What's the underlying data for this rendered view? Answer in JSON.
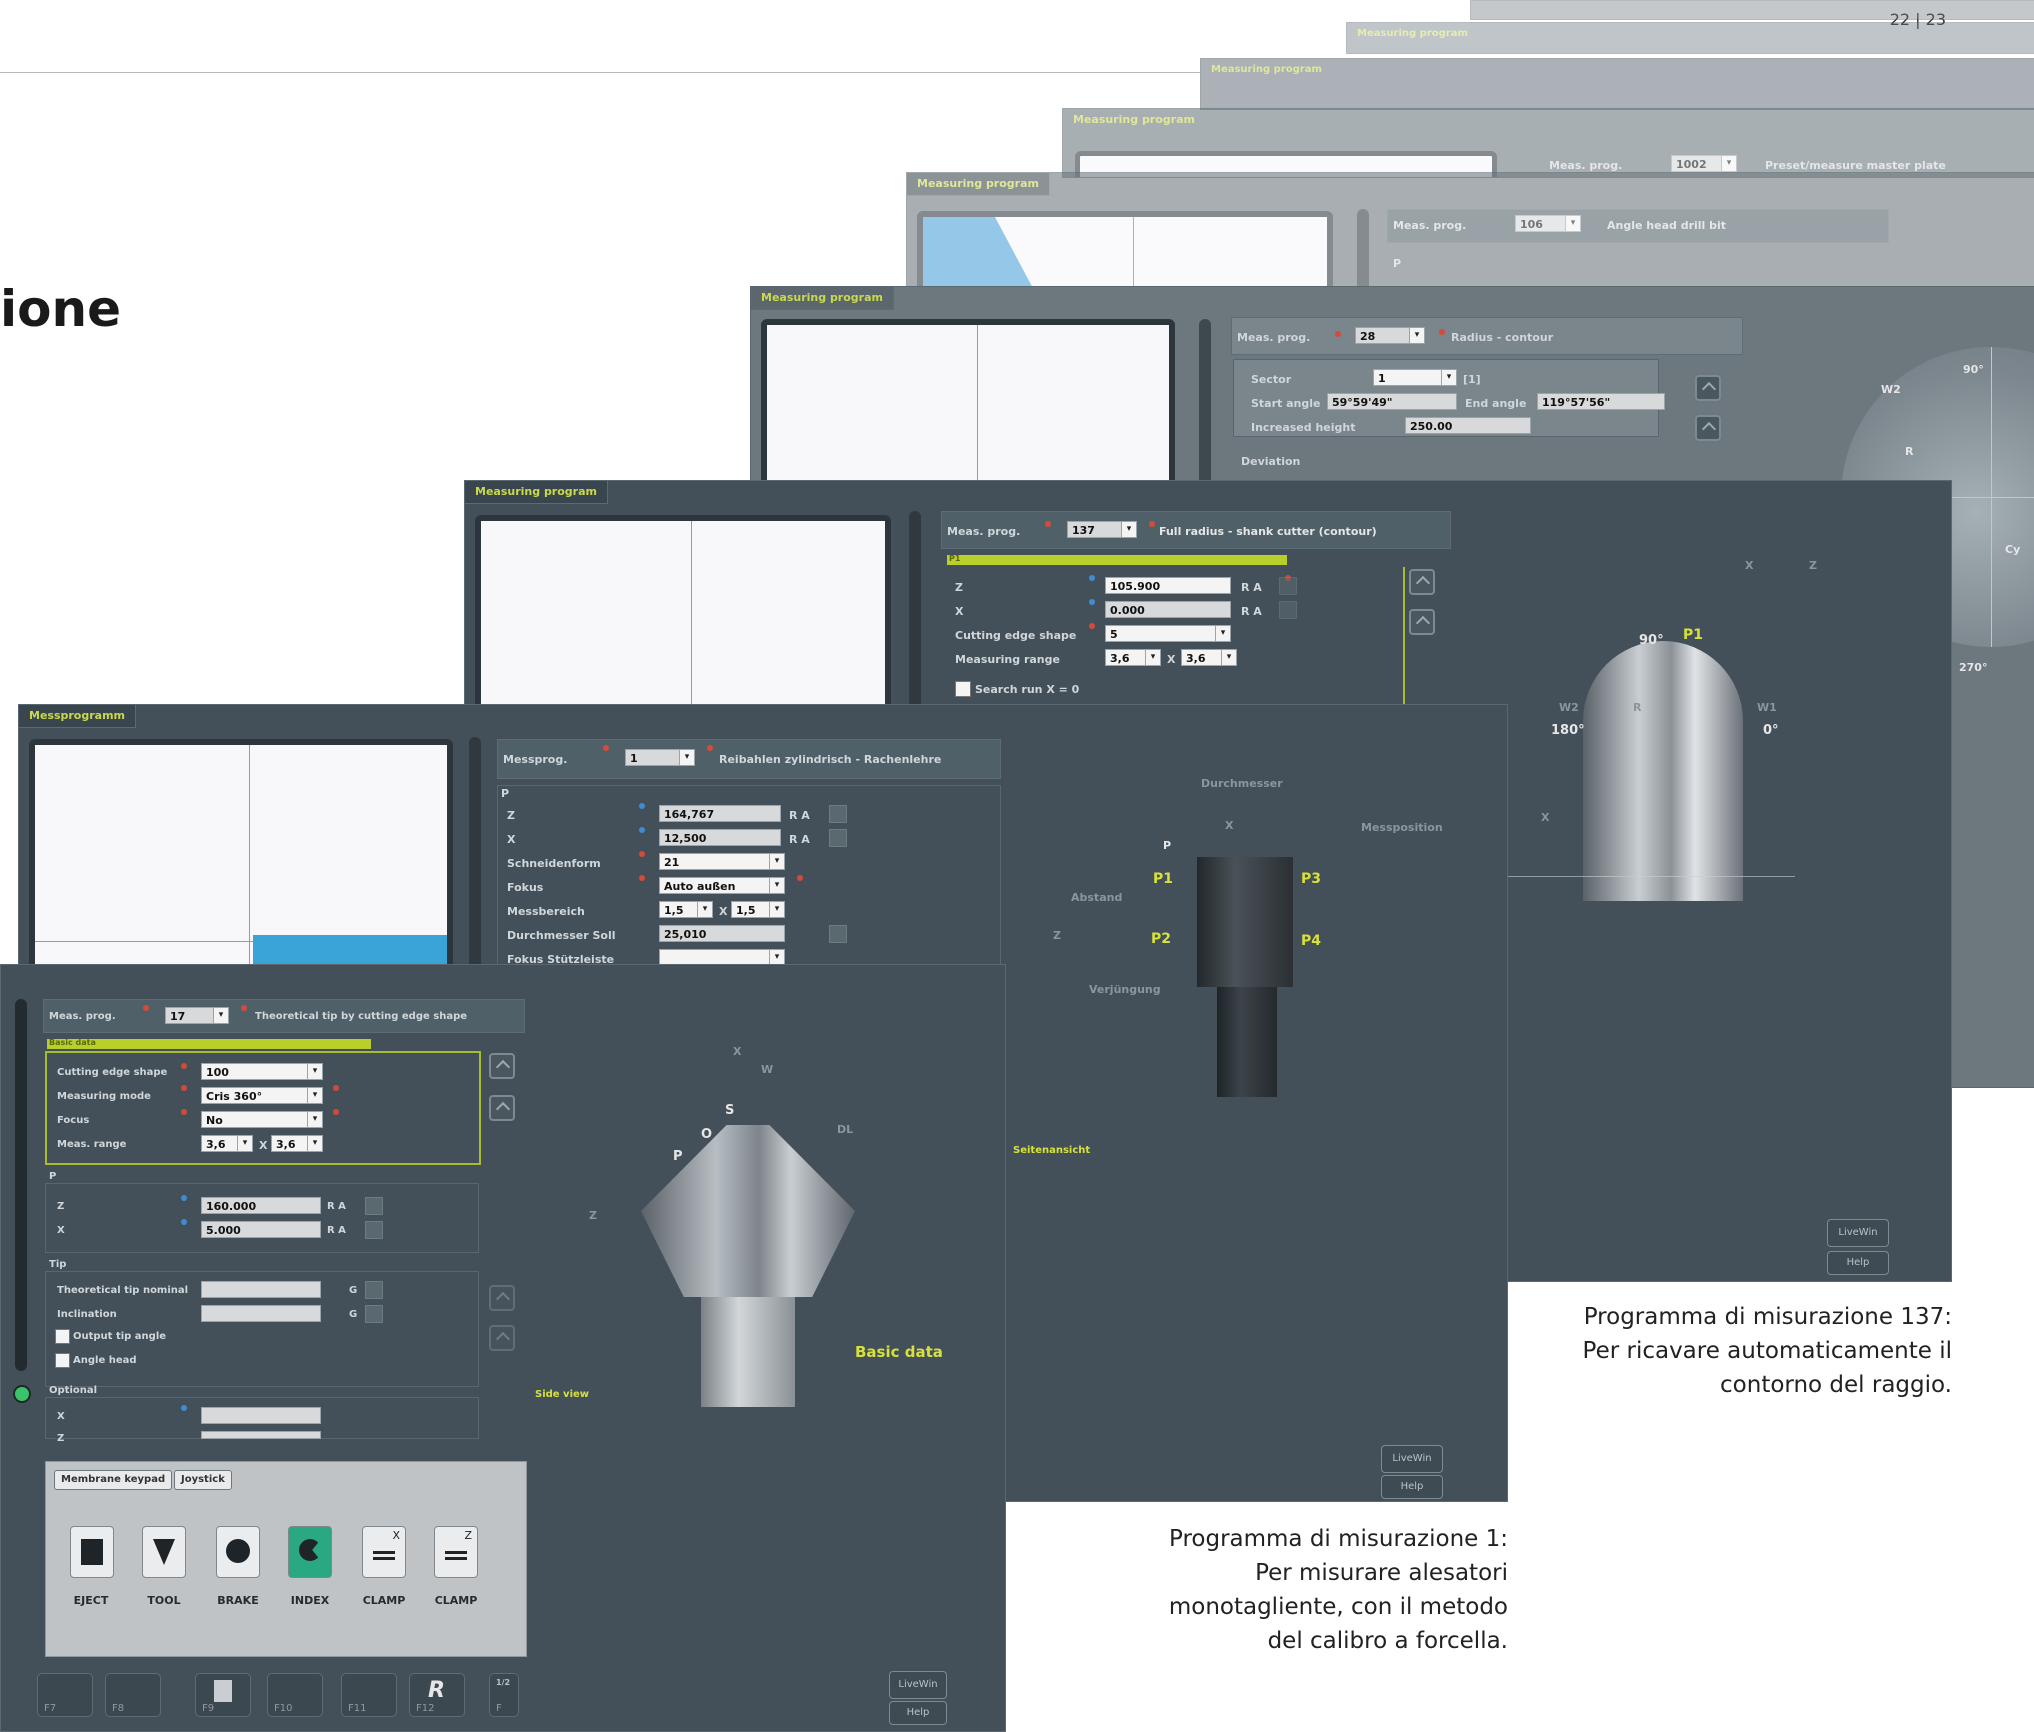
{
  "page": {
    "page_number": "22 | 23",
    "title_fragment": "ione"
  },
  "captions": {
    "prog137": [
      "Programma di misurazione 137:",
      "Per ricavare automaticamente il",
      "contorno del raggio."
    ],
    "prog1": [
      "Programma di misurazione 1:",
      "Per misurare alesatori",
      "monotagliente, con il metodo",
      "del calibro a forcella."
    ]
  },
  "colors": {
    "screen_bg": "#435059",
    "accent_green": "#b9cf2c",
    "label_yellow": "#d8e13a",
    "key_active": "#2aa882"
  },
  "screens": {
    "s1002": {
      "label": "Measuring program",
      "meas_prog_label": "Meas. prog.",
      "prog": "1002",
      "desc": "Preset/measure master plate"
    },
    "s106": {
      "label": "Measuring program",
      "meas_prog_label": "Meas. prog.",
      "prog": "106",
      "desc": "Angle head drill bit",
      "p": "P"
    },
    "s28": {
      "label": "Measuring program",
      "meas_prog_label": "Meas. prog.",
      "prog": "28",
      "desc": "Radius - contour",
      "sector_label": "Sector",
      "sector": "1",
      "sector_unit": "[1]",
      "start_angle_label": "Start angle",
      "start_angle": "59°59'49\"",
      "end_angle_label": "End angle",
      "end_angle": "119°57'56\"",
      "increased_height_label": "Increased height",
      "increased_height": "250.00",
      "deviation_label": "Deviation",
      "angles": {
        "a90": "90°",
        "a270": "270°",
        "w2": "W2",
        "r": "R",
        "cy": "Cy"
      }
    },
    "s137": {
      "label": "Measuring program",
      "meas_prog_label": "Meas. prog.",
      "prog": "137",
      "desc": "Full radius - shank cutter (contour)",
      "section": "P1",
      "z_label": "Z",
      "z": "105.900",
      "x_label": "X",
      "x": "0.000",
      "ra": "R A",
      "cutting_edge_label": "Cutting edge shape",
      "cutting_edge": "5",
      "range_label": "Measuring range",
      "range_a": "3,6",
      "range_b": "3,6",
      "times": "X",
      "search_label": "Search run X = 0",
      "diagram": {
        "x": "X",
        "z": "Z",
        "angle90": "90°",
        "p1": "P1",
        "w2": "W2",
        "w1": "W1",
        "a180": "180°",
        "a0": "0°",
        "r": "R",
        "xarrow": "X"
      },
      "livewin": "LiveWin",
      "help": "Help"
    },
    "s1": {
      "label": "Messprogramm",
      "meas_prog_label": "Messprog.",
      "prog": "1",
      "desc": "Reibahlen zylindrisch - Rachenlehre",
      "p": "P",
      "z_label": "Z",
      "z": "164,767",
      "x_label": "X",
      "x": "12,500",
      "ra": "R A",
      "edge_label": "Schneidenform",
      "edge": "21",
      "focus_label": "Fokus",
      "focus": "Auto außen",
      "range_label": "Messbereich",
      "range_a": "1,5",
      "range_b": "1,5",
      "times": "X",
      "diameter_label": "Durchmesser Soll",
      "diameter": "25,010",
      "support_label": "Fokus Stützleiste",
      "diagram": {
        "durchmesser": "Durchmesser",
        "x": "X",
        "messposition": "Messposition",
        "p": "P",
        "p1": "P1",
        "p2": "P2",
        "p3": "P3",
        "p4": "P4",
        "abstand": "Abstand",
        "z": "Z",
        "verjuengung": "Verjüngung"
      },
      "side_label": "Seitenansicht",
      "livewin": "LiveWin",
      "help": "Help"
    },
    "s17": {
      "meas_prog_label": "Meas. prog.",
      "prog": "17",
      "desc": "Theoretical tip by cutting edge shape",
      "section": "Basic data",
      "edge_label": "Cutting edge shape",
      "edge": "100",
      "mode_label": "Measuring mode",
      "mode": "Cris 360°",
      "focus_label": "Focus",
      "focus": "No",
      "range_label": "Meas. range",
      "range_a": "3,6",
      "range_b": "3,6",
      "times": "X",
      "p": "P",
      "z_label": "Z",
      "z": "160.000",
      "x_label": "X",
      "x": "5.000",
      "ra": "R A",
      "tip_label": "Tip",
      "tip_nominal_label": "Theoretical tip nominal",
      "inclination_label": "Inclination",
      "g": "G",
      "output_tip_label": "Output tip angle",
      "angle_head_label": "Angle head",
      "optional_label": "Optional",
      "opt_x": "X",
      "opt_z": "Z",
      "diagram": {
        "x": "X",
        "w": "W",
        "s": "S",
        "o": "O",
        "p": "P",
        "dl": "DL",
        "z": "Z"
      },
      "basic_data": "Basic data",
      "side_view": "Side view",
      "keypad": {
        "tab_membrane": "Membrane keypad",
        "tab_joystick": "Joystick",
        "keys": [
          "EJECT",
          "TOOL",
          "BRAKE",
          "INDEX",
          "CLAMP",
          "CLAMP"
        ],
        "clamp_x": "X",
        "clamp_z": "Z"
      },
      "fkeys": [
        "F7",
        "F8",
        "F9",
        "F10",
        "F11",
        "F12",
        "F"
      ],
      "page_fraction": "1/2",
      "livewin": "LiveWin",
      "help": "Help"
    }
  }
}
